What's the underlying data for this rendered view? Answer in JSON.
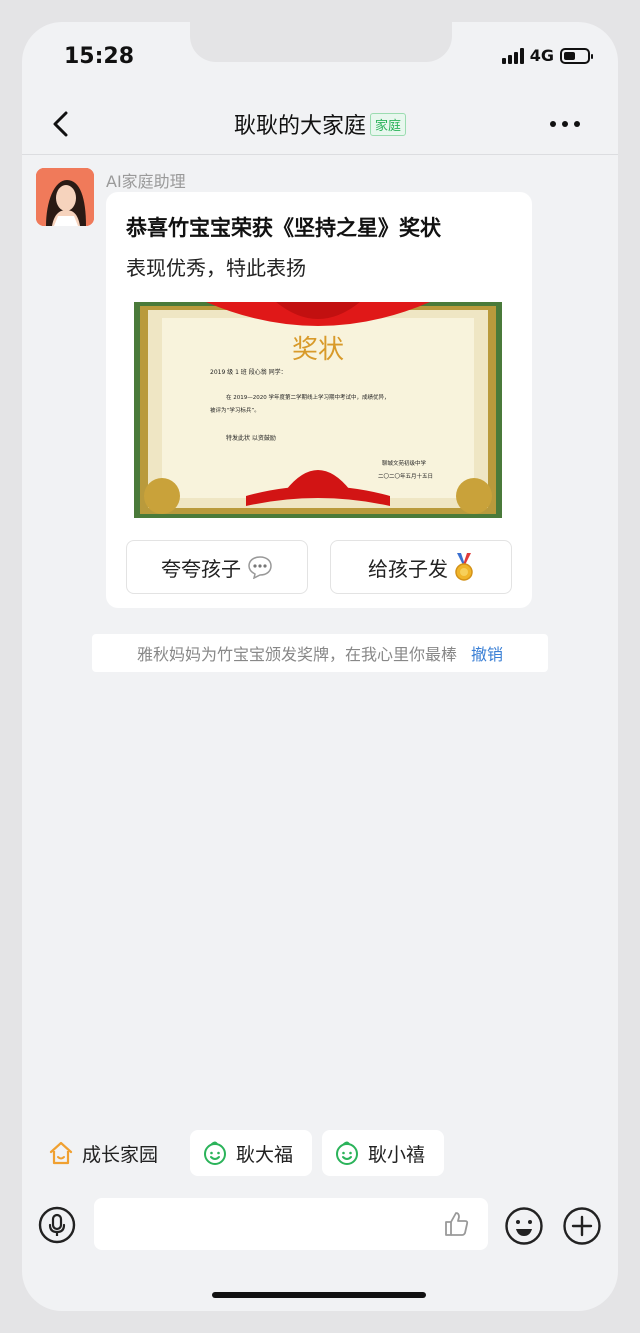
{
  "status": {
    "time": "15:28",
    "network": "4G"
  },
  "nav": {
    "title": "耿耿的大家庭",
    "tag": "家庭"
  },
  "message": {
    "sender": "AI家庭助理",
    "title": "恭喜竹宝宝荣获《坚持之星》奖状",
    "subtitle": "表现优秀，特此表扬",
    "certificate": {
      "heading": "奖状",
      "line1": "2019 级 1 班  段心翁  同学：",
      "line2": "在 2019—2020 学年度第二学期线上学习期中考试中，成绩优异，",
      "line3": "被评为“学习标兵”。",
      "line4": "特发此状    以资鼓励",
      "school": "聊城文苑初级中学",
      "date": "二〇二〇年五月十五日"
    },
    "buttons": {
      "praise": "夸夸孩子",
      "award": "给孩子发"
    }
  },
  "notice": {
    "text": "雅秋妈妈为竹宝宝颁发奖牌，在我心里你最棒",
    "undo": "撤销"
  },
  "quick_chips": [
    {
      "label": "成长家园",
      "icon": "house-icon"
    },
    {
      "label": "耿大福",
      "icon": "baby-face-icon"
    },
    {
      "label": "耿小禧",
      "icon": "baby-face-icon"
    }
  ],
  "colors": {
    "accent_green": "#2bb35a",
    "link_blue": "#3a7fd5",
    "icon_orange": "#f0a030"
  }
}
